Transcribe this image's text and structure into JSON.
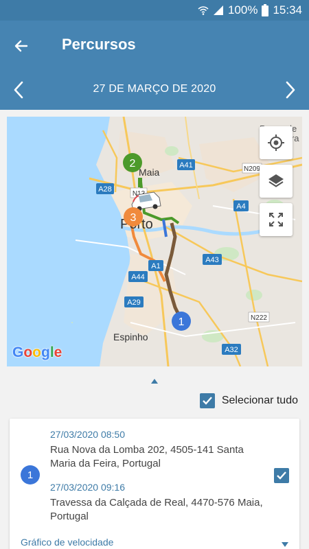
{
  "status_bar": {
    "battery": "100%",
    "time": "15:34"
  },
  "app_bar": {
    "title": "Percursos",
    "date": "27 DE MARÇO DE 2020"
  },
  "map": {
    "labels": {
      "pacos": "Paços de",
      "ferreira": "Ferreira",
      "maia": "Maia",
      "porto": "Porto",
      "espinho": "Espinho",
      "a41": "A41",
      "a28": "A28",
      "n13": "N13",
      "n209": "N209",
      "a4": "A4",
      "a43": "A43",
      "a1": "A1",
      "a44": "A44",
      "a29": "A29",
      "n222": "N222",
      "a32": "A32"
    },
    "markers": {
      "m1": "1",
      "m2": "2",
      "m3": "3"
    },
    "route_colors": {
      "route1": "#7a5a3a",
      "route2": "#4c9a2a",
      "route3": "#f08a3c"
    }
  },
  "select_all": {
    "label": "Selecionar tudo",
    "checked": true
  },
  "trip": {
    "badge": "1",
    "start_time": "27/03/2020 08:50",
    "start_address": "Rua Nova da Lomba 202, 4505-141 Santa Maria da Feira, Portugal",
    "end_time": "27/03/2020 09:16",
    "end_address": "Travessa da Calçada de Real, 4470-576 Maia, Portugal",
    "checked": true,
    "speed_chart_label": "Gráfico de velocidade"
  }
}
